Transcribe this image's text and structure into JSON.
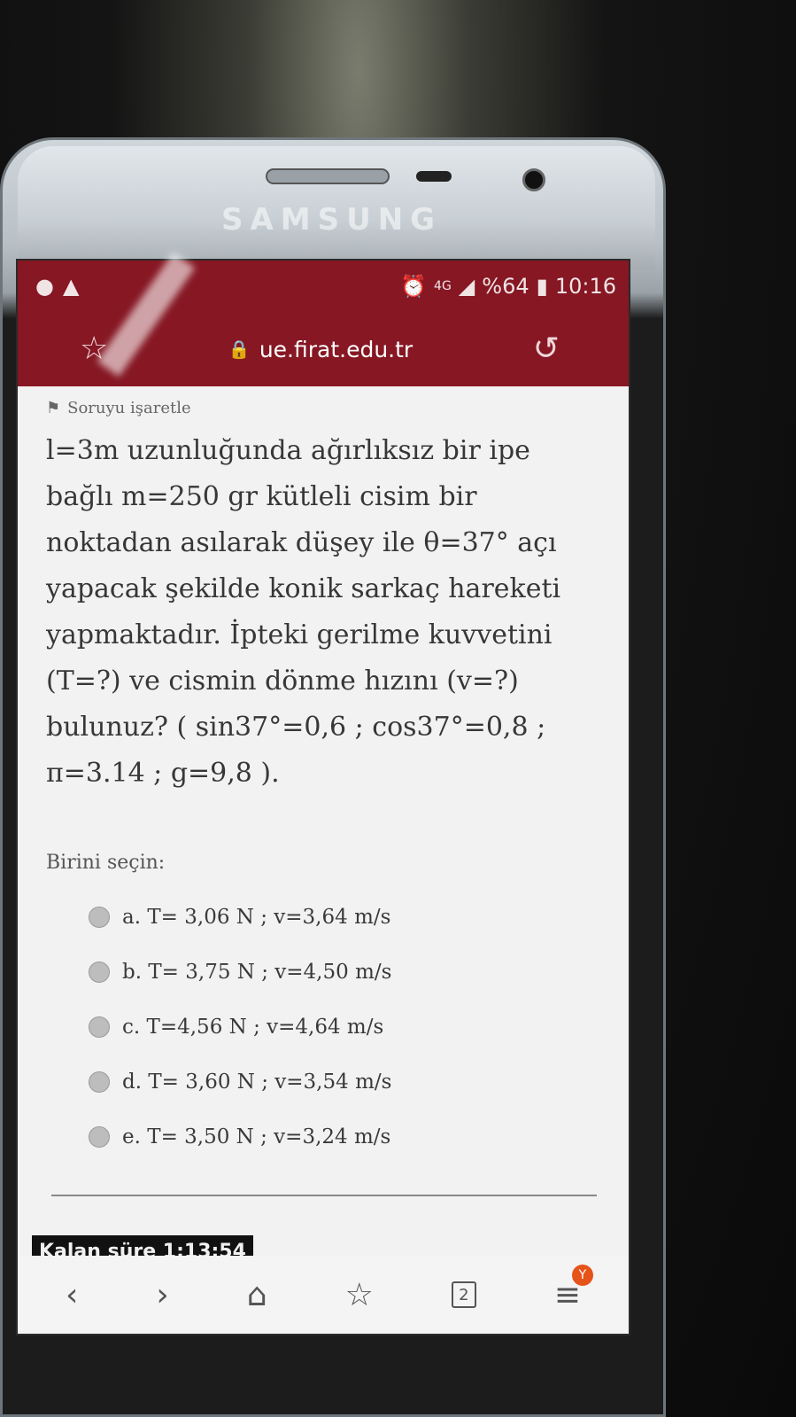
{
  "device": {
    "brand": "SAMSUNG"
  },
  "statusbar": {
    "battery": "%64",
    "time": "10:16",
    "signal": "4G"
  },
  "browser": {
    "url": "ue.firat.edu.tr",
    "tab_count": "2",
    "badge": "Y"
  },
  "quiz": {
    "flag_label": "Soruyu işaretle",
    "question": "l=3m uzunluğunda ağırlıksız bir ipe bağlı m=250 gr kütleli cisim bir noktadan asılarak düşey ile θ=37° açı yapacak şekilde konik sarkaç hareketi yapmaktadır. İpteki gerilme kuvvetini (T=?) ve cismin dönme hızını (v=?) bulunuz? ( sin37°=0,6 ; cos37°=0,8 ; π=3.14 ; g=9,8 ).",
    "prompt": "Birini seçin:",
    "options": [
      "a. T= 3,06 N  ;  v=3,64 m/s",
      "b. T= 3,75 N  ;   v=4,50 m/s",
      "c. T=4,56 N ;   v=4,64 m/s",
      "d. T= 3,60 N ;  v=3,54 m/s",
      "e. T= 3,50 N  ;  v=3,24 m/s"
    ],
    "timer": "Kalan süre 1:13:54"
  }
}
